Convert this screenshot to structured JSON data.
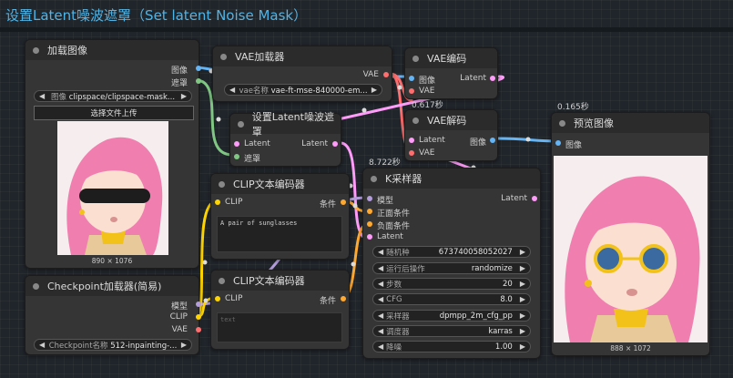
{
  "title": "设置Latent噪波遮罩（Set latent Noise Mask）",
  "colors": {
    "image": "#64b5f6",
    "mask": "#81c784",
    "latent": "#ff9cf9",
    "vae": "#ff6e6e",
    "clip": "#ffd500",
    "model": "#b39ddb",
    "conditioning": "#ffa931"
  },
  "nodes": {
    "load_image": {
      "title": "加载图像",
      "out_image": "图像",
      "out_mask": "遮罩",
      "image_key": "图像",
      "image_val": "clipspace/clipspace-mask...",
      "upload_label": "选择文件上传",
      "img_size": "890 × 1076"
    },
    "vae_loader": {
      "title": "VAE加载器",
      "out_vae": "VAE",
      "key": "vae名称",
      "val": "vae-ft-mse-840000-em..."
    },
    "set_mask": {
      "title": "设置Latent噪波遮罩",
      "in_latent": "Latent",
      "in_mask": "遮罩",
      "out_latent": "Latent"
    },
    "vae_encode": {
      "title": "VAE编码",
      "in_image": "图像",
      "in_vae": "VAE",
      "out_latent": "Latent",
      "time": "0.617秒"
    },
    "vae_decode": {
      "title": "VAE解码",
      "in_latent": "Latent",
      "in_vae": "VAE",
      "out_image": "图像"
    },
    "preview": {
      "title": "预览图像",
      "in_image": "图像",
      "time": "0.165秒",
      "img_size": "888 × 1072"
    },
    "clip_pos": {
      "title": "CLIP文本编码器",
      "in_clip": "CLIP",
      "out_cond": "条件",
      "text": "A pair of sunglasses"
    },
    "clip_neg": {
      "title": "CLIP文本编码器",
      "in_clip": "CLIP",
      "out_cond": "条件",
      "text": "",
      "placeholder": "text"
    },
    "checkpoint": {
      "title": "Checkpoint加载器(简易)",
      "out_model": "模型",
      "out_clip": "CLIP",
      "out_vae": "VAE",
      "key": "Checkpoint名称",
      "val": "512-inpainting-..."
    },
    "ksampler": {
      "title": "K采样器",
      "time": "8.722秒",
      "in_model": "模型",
      "in_pos": "正面条件",
      "in_neg": "负面条件",
      "in_latent": "Latent",
      "out_latent": "Latent",
      "widgets": [
        {
          "k": "随机种",
          "v": "673740058052027"
        },
        {
          "k": "运行后操作",
          "v": "randomize"
        },
        {
          "k": "步数",
          "v": "20"
        },
        {
          "k": "CFG",
          "v": "8.0"
        },
        {
          "k": "采样器",
          "v": "dpmpp_2m_cfg_pp"
        },
        {
          "k": "调度器",
          "v": "karras"
        },
        {
          "k": "降噪",
          "v": "1.00"
        }
      ]
    }
  }
}
